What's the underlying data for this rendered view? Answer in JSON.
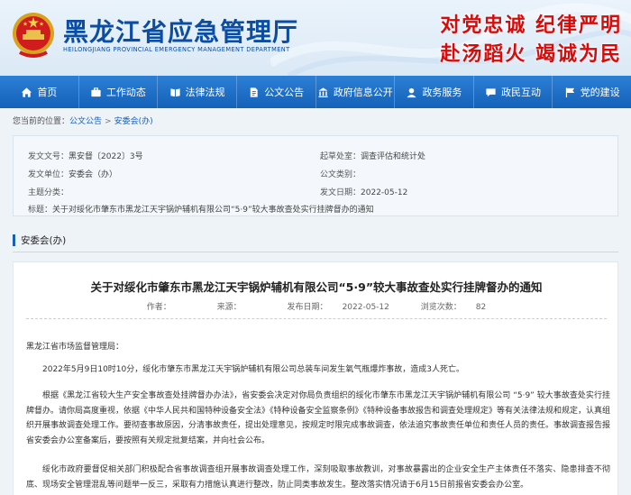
{
  "header": {
    "site_title": "黑龙江省应急管理厅",
    "site_subtitle": "HEILONGJIANG PROVINCIAL EMERGENCY MANAGEMENT DEPARTMENT",
    "slogan_line1": "对党忠诚  纪律严明",
    "slogan_line2": "赴汤蹈火  竭诚为民",
    "accent_color": "#0b4da2",
    "slogan_color": "#d40c0c"
  },
  "nav": {
    "items": [
      {
        "label": "首页",
        "icon": "home-icon"
      },
      {
        "label": "工作动态",
        "icon": "briefcase-icon"
      },
      {
        "label": "法律法规",
        "icon": "book-icon"
      },
      {
        "label": "公文公告",
        "icon": "document-icon"
      },
      {
        "label": "政府信息公开",
        "icon": "building-icon"
      },
      {
        "label": "政务服务",
        "icon": "service-icon"
      },
      {
        "label": "政民互动",
        "icon": "chat-icon"
      },
      {
        "label": "党的建设",
        "icon": "flag-icon"
      }
    ],
    "bg_color": "#1f6fc8"
  },
  "breadcrumb": {
    "prefix": "您当前的位置：",
    "items": [
      "公文公告",
      "安委会(办)"
    ],
    "separator": ">"
  },
  "info": {
    "doc_no_label": "发文文号：",
    "doc_no": "黑安督〔2022〕3号",
    "drafting_label": "起草处室：",
    "drafting": "调查评估和统计处",
    "issuer_label": "发文单位：",
    "issuer": "安委会（办）",
    "category_label": "公文类别：",
    "category": "",
    "topic_label": "主题分类：",
    "topic": "",
    "date_label": "发文日期：",
    "date": "2022-05-12",
    "title_label": "标题：",
    "title": "关于对绥化市肇东市黑龙江天宇锅炉辅机有限公司“5·9”较大事故查处实行挂牌督办的通知"
  },
  "section": {
    "label": "安委会(办)"
  },
  "article": {
    "title": "关于对绥化市肇东市黑龙江天宇锅炉辅机有限公司“5·9”较大事故查处实行挂牌督办的通知",
    "author_label": "作者：",
    "author": "",
    "source_label": "来源：",
    "source": "",
    "date_label": "发布日期：",
    "date": "2022-05-12",
    "views_label": "浏览次数：",
    "views": "82",
    "addressee": "黑龙江省市场监督管理局：",
    "para1": "2022年5月9日10时10分，绥化市肇东市黑龙江天宇锅炉辅机有限公司总装车间发生氧气瓶爆炸事故，造成3人死亡。",
    "para2": "根据《黑龙江省较大生产安全事故查处挂牌督办办法》，省安委会决定对你局负责组织的绥化市肇东市黑龙江天宇锅炉辅机有限公司 “5·9” 较大事故查处实行挂牌督办。请你局高度重视，依据《中华人民共和国特种设备安全法》《特种设备安全监察条例》《特种设备事故报告和调查处理规定》等有关法律法规和规定，认真组织开展事故调查处理工作。要彻查事故原因，分清事故责任，提出处理意见，按规定时限完成事故调查，依法追究事故责任单位和责任人员的责任。事故调查报告报省安委会办公室备案后，要按照有关规定批复结案，并向社会公布。",
    "para3": "绥化市政府要督促相关部门积极配合省事故调查组开展事故调查处理工作，深刻吸取事故教训，对事故暴露出的企业安全生产主体责任不落实、隐患排查不彻底、现场安全管理混乱等问题举一反三，采取有力措施认真进行整改，防止同类事故发生。整改落实情况请于6月15日前报省安委会办公室。"
  }
}
